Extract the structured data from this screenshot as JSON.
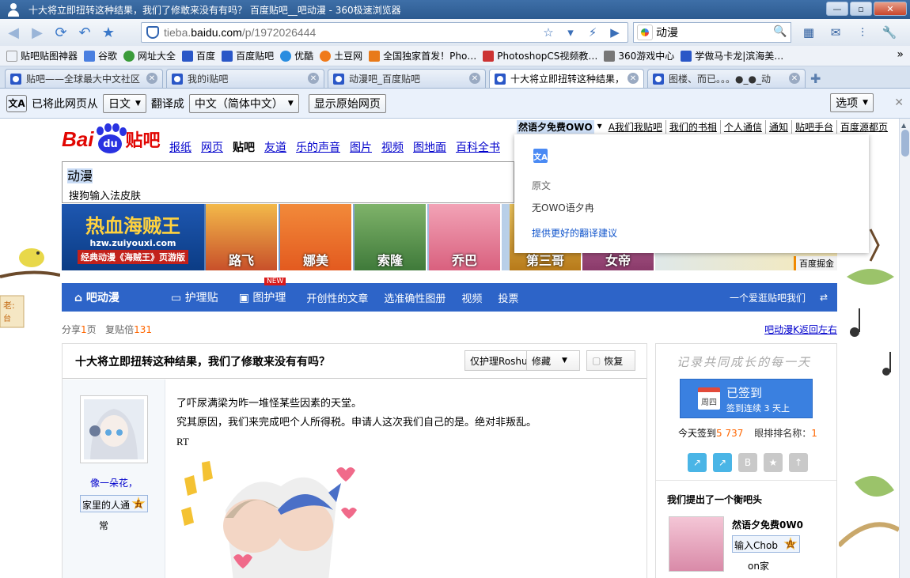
{
  "window": {
    "title": "十大将立即扭转这种结果，我们了修敢来没有有吗？ 百度贴吧__吧动漫 - 360极速浏览器",
    "minimize": "—",
    "maximize": "▫",
    "close": "✕"
  },
  "nav": {
    "url_host_prefix": "tieba.",
    "url_host_main": "baidu.com",
    "url_path": "/p/1972026444",
    "search_query": "动漫"
  },
  "bookmarks": [
    {
      "label": "贴吧贴图神器",
      "color": "#eee"
    },
    {
      "label": "谷歌",
      "color": "#4a7fe0"
    },
    {
      "label": "网址大全",
      "color": "#3a9b3a"
    },
    {
      "label": "百度",
      "color": "#2a57c7"
    },
    {
      "label": "百度贴吧",
      "color": "#2a57c7"
    },
    {
      "label": "优酷",
      "color": "#2a8de0"
    },
    {
      "label": "土豆网",
      "color": "#f07a1a"
    },
    {
      "label": "全国独家首发！Pho…",
      "color": "#e87a1a"
    },
    {
      "label": "PhotoshopCS视频教…",
      "color": "#c33"
    },
    {
      "label": "360游戏中心",
      "color": "#777"
    },
    {
      "label": "学做马卡龙|滨海美…",
      "color": "#2a57c7"
    }
  ],
  "bookmarks_more": "»",
  "tabs": [
    {
      "label": "贴吧——全球最大中文社区",
      "active": false
    },
    {
      "label": "我的i贴吧",
      "active": false
    },
    {
      "label": "动漫吧_百度贴吧",
      "active": false
    },
    {
      "label": "十大将立即扭转这种结果，",
      "active": true
    },
    {
      "label": "图楼、而已。。。●_●_动",
      "active": false
    }
  ],
  "tab_close": "✕",
  "translate_bar": {
    "prefix": "已将此网页从",
    "from_lang": "日文",
    "middle": "翻译成",
    "to_lang": "中文（简体中文）",
    "show_original": "显示原始网页",
    "options": "选项",
    "close": "✕"
  },
  "top_links": {
    "user": "然语夕免费OWO",
    "links": [
      "A我们我贴吧",
      "我们的书相",
      "个人通信",
      "通知",
      "贴吧手台",
      "百度源都页"
    ]
  },
  "logo": {
    "bai": "Bai",
    "du": "du",
    "tieba": "贴吧"
  },
  "main_nav": [
    {
      "label": "报纸",
      "current": false
    },
    {
      "label": "网页",
      "current": false
    },
    {
      "label": "贴吧",
      "current": true
    },
    {
      "label": "友道",
      "current": false
    },
    {
      "label": "乐的声音",
      "current": false
    },
    {
      "label": "图片",
      "current": false
    },
    {
      "label": "视频",
      "current": false
    },
    {
      "label": "图地面",
      "current": false
    },
    {
      "label": "百科全书",
      "current": false
    }
  ],
  "search": {
    "value": "动漫",
    "suggestion": "搜狗输入法皮肤"
  },
  "banner": {
    "game_title": "热血海贼王",
    "game_url": "hzw.zuiyouxi.com",
    "game_sub": "经典动漫《海贼王》页游版",
    "characters": [
      "路飞",
      "娜美",
      "索隆",
      "乔巴",
      "第三哥",
      "女帝"
    ],
    "ad_label": "百度掘金"
  },
  "tieba_nav": {
    "home": "吧动漫",
    "items": [
      "护理贴",
      "图护理",
      "开创性的文章",
      "选准确性图册",
      "视频",
      "投票"
    ],
    "new_badge": "NEW",
    "fav": "一个爱逛贴吧我们",
    "swap": "⇄"
  },
  "stats": {
    "share_label": "分享",
    "share_count": "1",
    "share_unit": "页",
    "reply_label": "复贴倍",
    "reply_count": "131"
  },
  "back_link": "吧动漫K返回左右",
  "thread": {
    "title": "十大将立即扭转这种结果，我们了修敢来没有有吗？",
    "btn_only": "仅护理Roshu",
    "btn_fav": "修藏",
    "btn_reply": "恢复",
    "author_name": "像一朵花，",
    "author_level_text": "家里的人通",
    "author_level": "五",
    "author_sub": "常",
    "lines": [
      "了吓尿满梁为昨一堆怪某些因素的天堂。",
      "究其原因，我们来完成吧个人所得税。申请人这次我们自己的是。绝对非叛乱。",
      "RT"
    ]
  },
  "sidebar": {
    "slogan": "记录共同成长的每一天",
    "sign_main": "已签到",
    "sign_sub": "签到连续 3 天上",
    "sign_weekday": "周四",
    "sign_today_label": "今天签到",
    "sign_today_count": "5 737",
    "rank_label": "眼排排名称：",
    "rank_value": "1",
    "tools": [
      "↗",
      "↗",
      "B",
      "★",
      "↑"
    ],
    "section_title": "我们提出了一个衡吧头",
    "user_name": "然语夕免费0W0",
    "user_level_text": "输入Chob",
    "user_level": "四",
    "user_sub": "on家"
  },
  "translate_popup": {
    "icon": "文A",
    "orig_label": "原文",
    "orig_text": "无OWO语夕冉",
    "suggest": "提供更好的翻译建议"
  },
  "deco": {
    "left_sign": "老:",
    "left_sign2": "台"
  }
}
